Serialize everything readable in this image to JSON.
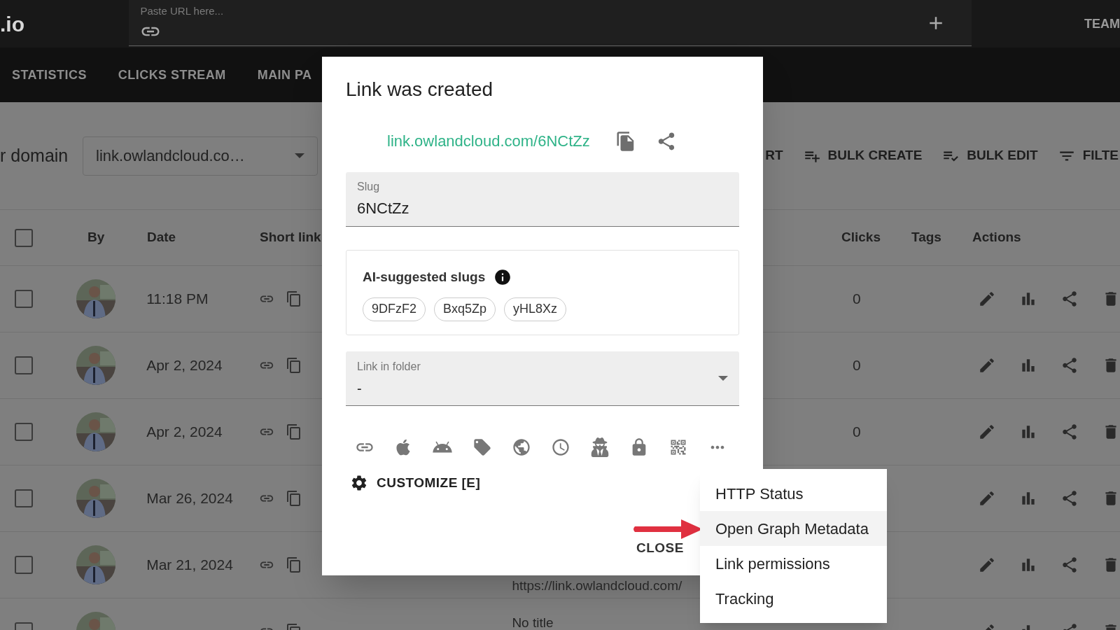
{
  "header": {
    "logo": ".io",
    "url_field": {
      "placeholder": "Paste URL here..."
    },
    "team": "TEAM"
  },
  "nav_tabs": [
    {
      "label": "STATISTICS"
    },
    {
      "label": "CLICKS STREAM"
    },
    {
      "label": "MAIN PA"
    }
  ],
  "toolbar": {
    "domain_label": "r domain",
    "domain_select": "link.owlandcloud.co…",
    "actions": [
      {
        "label": "RT",
        "kind": "plain"
      },
      {
        "label": "BULK CREATE",
        "kind": "add"
      },
      {
        "label": "BULK EDIT",
        "kind": "edit"
      },
      {
        "label": "FILTE",
        "kind": "filter"
      }
    ]
  },
  "table": {
    "select_all_checked": false,
    "columns": [
      "By",
      "Date",
      "Short link",
      "Clicks",
      "Tags",
      "Actions"
    ],
    "rows": [
      {
        "checked": false,
        "date": "11:18 PM",
        "clicks": "0"
      },
      {
        "checked": false,
        "date": "Apr 2, 2024",
        "clicks": "0"
      },
      {
        "checked": false,
        "date": "Apr 2, 2024",
        "clicks": "0"
      },
      {
        "checked": false,
        "date": "Mar 26, 2024"
      },
      {
        "checked": false,
        "date": "Mar 21, 2024",
        "url": "https://link.owlandcloud.com/"
      },
      {
        "checked": false,
        "title": "No title"
      }
    ]
  },
  "dialog": {
    "title": "Link was created",
    "short_url": "link.owlandcloud.com/6NCtZz",
    "slug": {
      "label": "Slug",
      "value": "6NCtZz"
    },
    "suggestions": {
      "title": "AI-suggested slugs",
      "chips": [
        "9DFzF2",
        "Bxq5Zp",
        "yHL8Xz"
      ]
    },
    "folder": {
      "label": "Link in folder",
      "value": "-"
    },
    "customize": "CUSTOMIZE [E]",
    "close": "CLOSE"
  },
  "menu": {
    "items": [
      {
        "label": "HTTP Status",
        "selected": false
      },
      {
        "label": "Open Graph Metadata",
        "selected": true
      },
      {
        "label": "Link permissions",
        "selected": false
      },
      {
        "label": "Tracking",
        "selected": false
      }
    ]
  }
}
